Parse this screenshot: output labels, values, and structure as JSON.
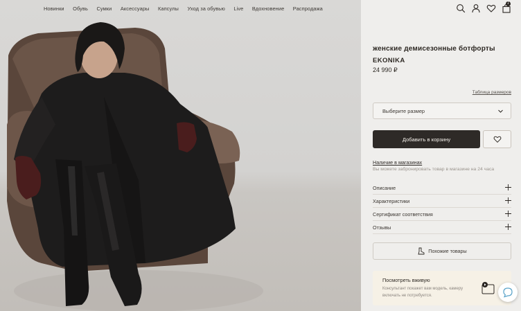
{
  "nav": {
    "items": [
      "Новинки",
      "Обувь",
      "Сумки",
      "Аксессуары",
      "Капсулы",
      "Уход за обувью",
      "Live",
      "Вдохновение",
      "Распродажа"
    ]
  },
  "header_icons": {
    "search": "search-icon",
    "account": "user-icon",
    "favorites": "heart-icon",
    "cart": "bag-icon",
    "cart_count": "1"
  },
  "product": {
    "title": "женские демисезонные ботфорты",
    "brand": "EKONIKA",
    "price": "24 990 ₽"
  },
  "size": {
    "table_link": "Таблица размеров",
    "select_placeholder": "Выберите размер"
  },
  "actions": {
    "add_to_cart": "Добавить в корзину"
  },
  "availability": {
    "link": "Наличие в магазинах",
    "note": "Вы можете забронировать товар в магазине на 24 часа"
  },
  "accordion": [
    "Описание",
    "Характеристики",
    "Сертификат соответствия",
    "Отзывы"
  ],
  "similar": {
    "label": "Похожие товары"
  },
  "live": {
    "heading": "Посмотреть вживую",
    "description": "Консультант покажет вам модель, камеру включать не потребуется."
  },
  "colors": {
    "accent_dark": "#2e2a27",
    "panel_bg": "#efeeec",
    "live_bg": "#f6f1e6"
  }
}
